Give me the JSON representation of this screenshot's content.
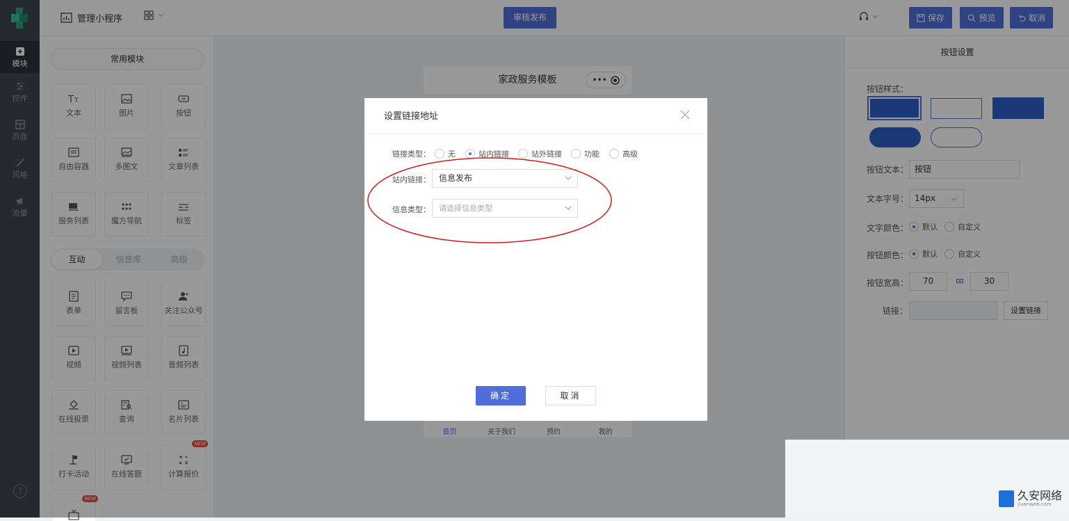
{
  "topbar": {
    "app_name": "管理小程序",
    "publish_label": "审核发布",
    "save_label": "保存",
    "preview_label": "预览",
    "cancel_label": "取消"
  },
  "rail": {
    "items": [
      {
        "label": "模块",
        "icon": "plus-square-icon",
        "active": true
      },
      {
        "label": "控件",
        "icon": "sliders-icon"
      },
      {
        "label": "页面",
        "icon": "layout-icon"
      },
      {
        "label": "风格",
        "icon": "magic-wand-icon"
      },
      {
        "label": "流量",
        "icon": "megaphone-icon"
      }
    ],
    "help_label": "?"
  },
  "left_panel": {
    "common_label": "常用模块",
    "common_tiles": [
      "文本",
      "图片",
      "按钮",
      "自由容器",
      "多图文",
      "文章列表",
      "服务列表",
      "魔方导航",
      "标签"
    ],
    "tabs": [
      "互动",
      "信息库",
      "高级"
    ],
    "interactive_tiles": [
      "表单",
      "留言板",
      "关注公众号",
      "视频",
      "视频列表",
      "音频列表",
      "在线投票",
      "查询",
      "名片列表",
      "打卡活动",
      "在线答题",
      "计算报价"
    ],
    "new_badge": "NEW"
  },
  "phone": {
    "title": "家政服务模板",
    "caps_dots": "•••",
    "nav": [
      "首页",
      "关于我们",
      "预约",
      "我的"
    ]
  },
  "right_panel": {
    "title": "按钮设置",
    "style_label": "按钮样式：",
    "text_label": "按钮文本：",
    "text_value": "按钮",
    "font_label": "文本字号：",
    "font_value": "14px",
    "text_color_label": "文字颜色：",
    "button_color_label": "按钮颜色：",
    "default_label": "默认",
    "custom_label": "自定义",
    "size_label": "按钮宽高：",
    "width_value": "70",
    "height_value": "30",
    "link_label": "链接：",
    "set_link_label": "设置链接"
  },
  "modal": {
    "title": "设置链接地址",
    "link_type_label": "链接类型：",
    "link_types": [
      "无",
      "站内链接",
      "站外链接",
      "功能",
      "高级"
    ],
    "selected_type": "站内链接",
    "internal_label": "站内链接：",
    "internal_value": "信息发布",
    "info_type_label": "信息类型：",
    "info_type_placeholder": "请选择信息类型",
    "ok_label": "确定",
    "cancel_label": "取消"
  },
  "watermark": {
    "name": "久安网络",
    "domain": "jiuanweb.com"
  },
  "colors": {
    "accent": "#4f6ed9",
    "rail": "#3f4750",
    "annotation": "#d01c1c"
  }
}
